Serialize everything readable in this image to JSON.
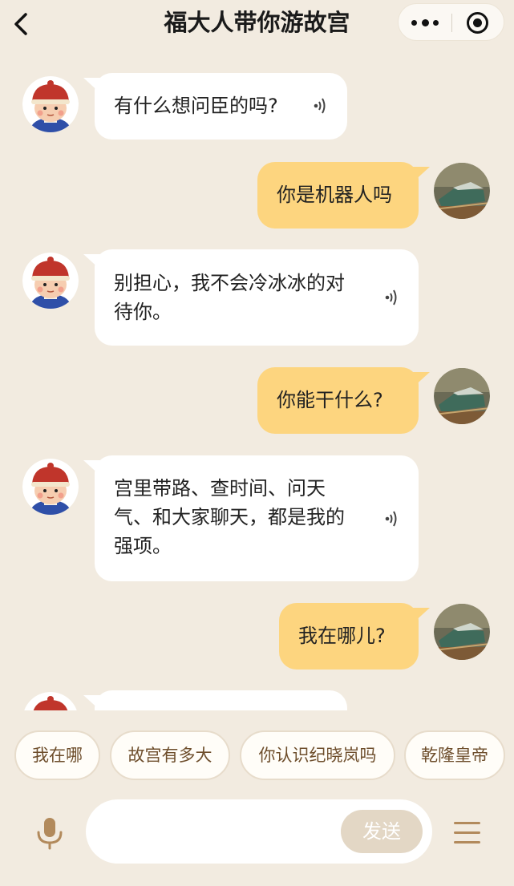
{
  "header": {
    "title": "福大人带你游故宫",
    "more_icon": "more-dots-icon",
    "close_icon": "target-close-icon"
  },
  "colors": {
    "background": "#f2ebe0",
    "bot_bubble": "#ffffff",
    "user_bubble": "#fdd57f",
    "chip_text": "#6e4e2c",
    "send_button": "#e3d7c5",
    "menu_icon": "#b28a5c"
  },
  "messages": [
    {
      "role": "bot",
      "text": "有什么想问臣的吗?",
      "voice_icon": "speaker-wave-icon"
    },
    {
      "role": "user",
      "text": "你是机器人吗"
    },
    {
      "role": "bot",
      "text": "别担心，我不会冷冰冰的对\n待你。",
      "voice_icon": "speaker-wave-icon"
    },
    {
      "role": "user",
      "text": "你能干什么?"
    },
    {
      "role": "bot",
      "text": "宫里带路、查时间、问天\n气、和大家聊天，都是我的\n强项。",
      "voice_icon": "speaker-wave-icon"
    },
    {
      "role": "user",
      "text": "我在哪儿?"
    },
    {
      "role": "bot",
      "text": ""
    }
  ],
  "quick_replies": [
    "我在哪",
    "故宫有多大",
    "你认识纪晓岚吗",
    "乾隆皇帝"
  ],
  "input": {
    "placeholder": "",
    "value": "",
    "send_label": "发送",
    "mic_icon": "microphone-icon",
    "menu_icon": "hamburger-menu-icon"
  }
}
